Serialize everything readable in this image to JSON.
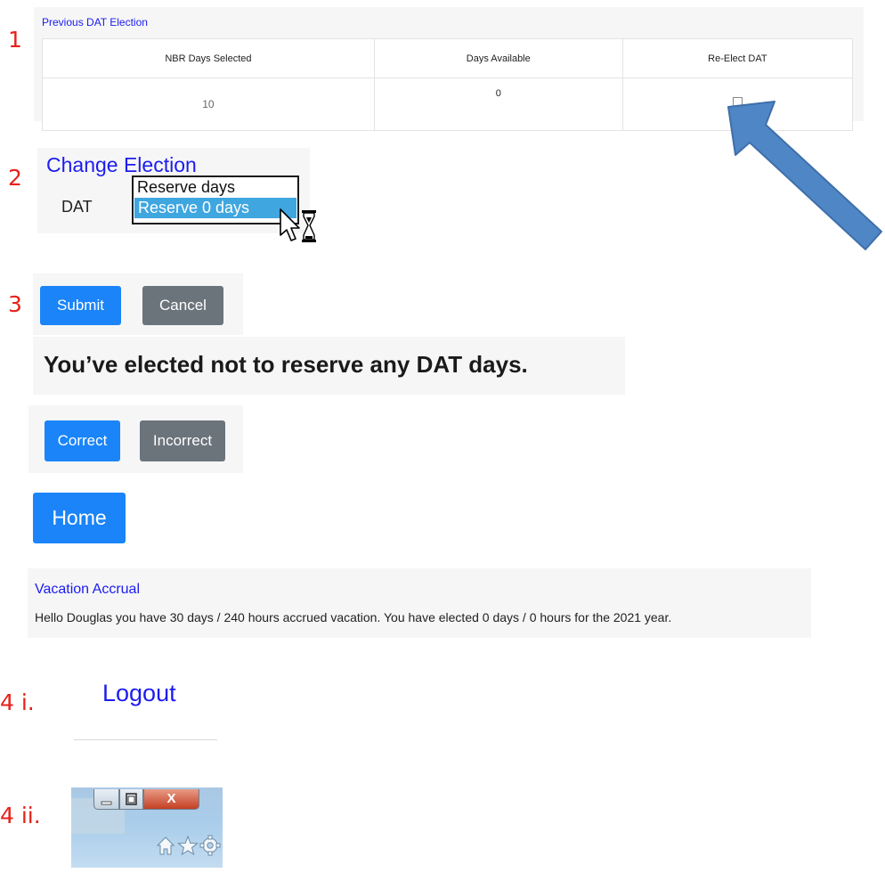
{
  "steps": {
    "s1": "1",
    "s2": "2",
    "s3": "3",
    "s4i": "4 i.",
    "s4ii": "4 ii."
  },
  "previous_election": {
    "title": "Previous DAT Election",
    "headers": [
      "NBR Days Selected",
      "Days Available",
      "Re-Elect DAT"
    ],
    "row": {
      "days_selected": "10",
      "days_available": "0",
      "re_elect_checked": false
    }
  },
  "change_election": {
    "title": "Change Election",
    "label": "DAT",
    "options": [
      "Reserve days",
      "Reserve 0 days"
    ],
    "highlighted": "Reserve 0 days"
  },
  "actions": {
    "submit": "Submit",
    "cancel": "Cancel"
  },
  "confirmation": {
    "message": "You’ve elected not to reserve any DAT days.",
    "correct": "Correct",
    "incorrect": "Incorrect"
  },
  "home": "Home",
  "vacation": {
    "title": "Vacation Accrual",
    "text": "Hello Douglas you have 30 days / 240 hours accrued vacation. You have elected 0 days / 0 hours for the 2021 year."
  },
  "logout": "Logout",
  "browser": {
    "close_label": "X",
    "icons": [
      "minimize-icon",
      "restore-icon",
      "close-icon",
      "home-icon",
      "star-icon",
      "gear-icon"
    ]
  },
  "colors": {
    "primary": "#1a84f8",
    "secondary": "#6b737b",
    "link": "#1c1cf0",
    "step": "#e8201a",
    "arrow": "#4f86c6",
    "highlight": "#3fa6e0"
  }
}
